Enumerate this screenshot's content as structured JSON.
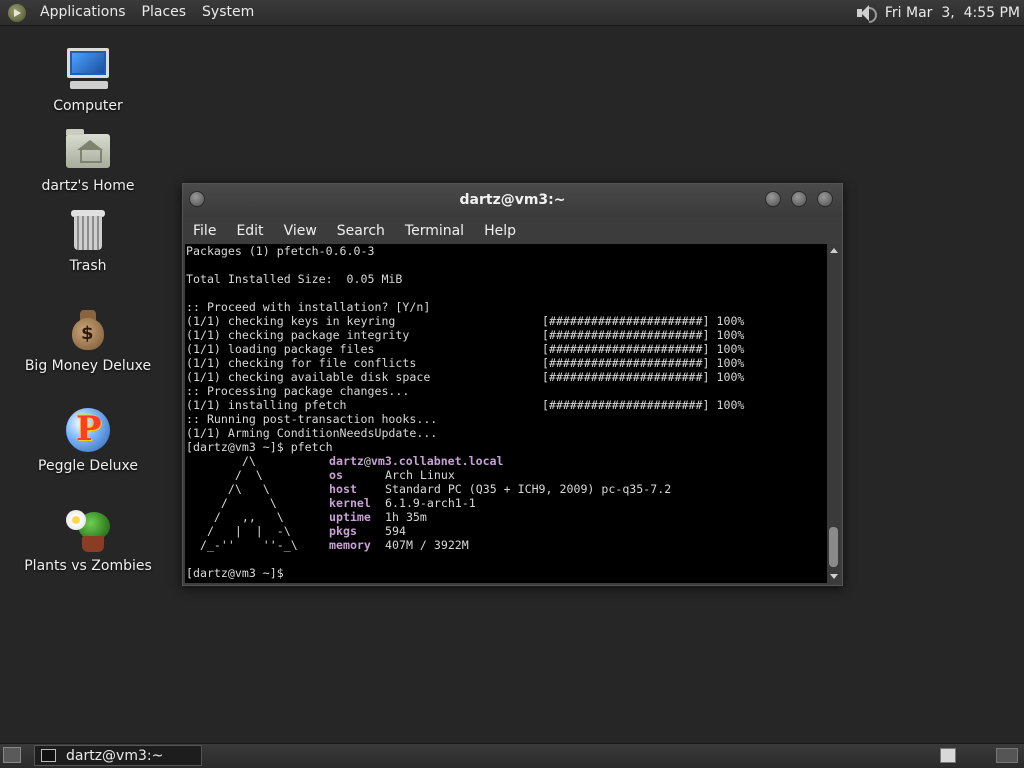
{
  "top_panel": {
    "menus": [
      "Applications",
      "Places",
      "System"
    ],
    "clock": "Fri Mar  3,  4:55 PM",
    "icons": [
      "distro-logo-icon",
      "volume-icon"
    ]
  },
  "desktop": {
    "icons": [
      {
        "label": "Computer",
        "icon": "computer-icon"
      },
      {
        "label": "dartz's Home",
        "icon": "home-folder-icon"
      },
      {
        "label": "Trash",
        "icon": "trash-icon"
      },
      {
        "label": "Big Money Deluxe",
        "icon": "money-bag-icon"
      },
      {
        "label": "Peggle Deluxe",
        "icon": "peggle-icon"
      },
      {
        "label": "Plants vs Zombies",
        "icon": "plants-icon"
      }
    ]
  },
  "terminal_window": {
    "title": "dartz@vm3:~",
    "menu": [
      "File",
      "Edit",
      "View",
      "Search",
      "Terminal",
      "Help"
    ],
    "lines": [
      "Packages (1) pfetch-0.6.0-3",
      "",
      "Total Installed Size:  0.05 MiB",
      "",
      ":: Proceed with installation? [Y/n]",
      "(1/1) checking keys in keyring                     [######################] 100%",
      "(1/1) checking package integrity                   [######################] 100%",
      "(1/1) loading package files                        [######################] 100%",
      "(1/1) checking for file conflicts                  [######################] 100%",
      "(1/1) checking available disk space                [######################] 100%",
      ":: Processing package changes...",
      "(1/1) installing pfetch                            [######################] 100%",
      ":: Running post-transaction hooks...",
      "(1/1) Arming ConditionNeedsUpdate...",
      "[dartz@vm3 ~]$ pfetch"
    ],
    "pfetch": {
      "art": [
        "        /\\",
        "       /  \\",
        "      /\\   \\",
        "     /      \\",
        "    /   ,,   \\",
        "   /   |  |  -\\",
        "  /_-''    ''-_\\"
      ],
      "rows": [
        {
          "key": "dartz",
          "sep": "@",
          "value": "vm3.collabnet.local"
        },
        {
          "key": "os",
          "value": "Arch Linux"
        },
        {
          "key": "host",
          "value": "Standard PC (Q35 + ICH9, 2009) pc-q35-7.2"
        },
        {
          "key": "kernel",
          "value": "6.1.9-arch1-1"
        },
        {
          "key": "uptime",
          "value": "1h 35m"
        },
        {
          "key": "pkgs",
          "value": "594"
        },
        {
          "key": "memory",
          "value": "407M / 3922M"
        }
      ]
    },
    "final_prompt": "[dartz@vm3 ~]$"
  },
  "taskbar": {
    "task_label": "dartz@vm3:~"
  }
}
